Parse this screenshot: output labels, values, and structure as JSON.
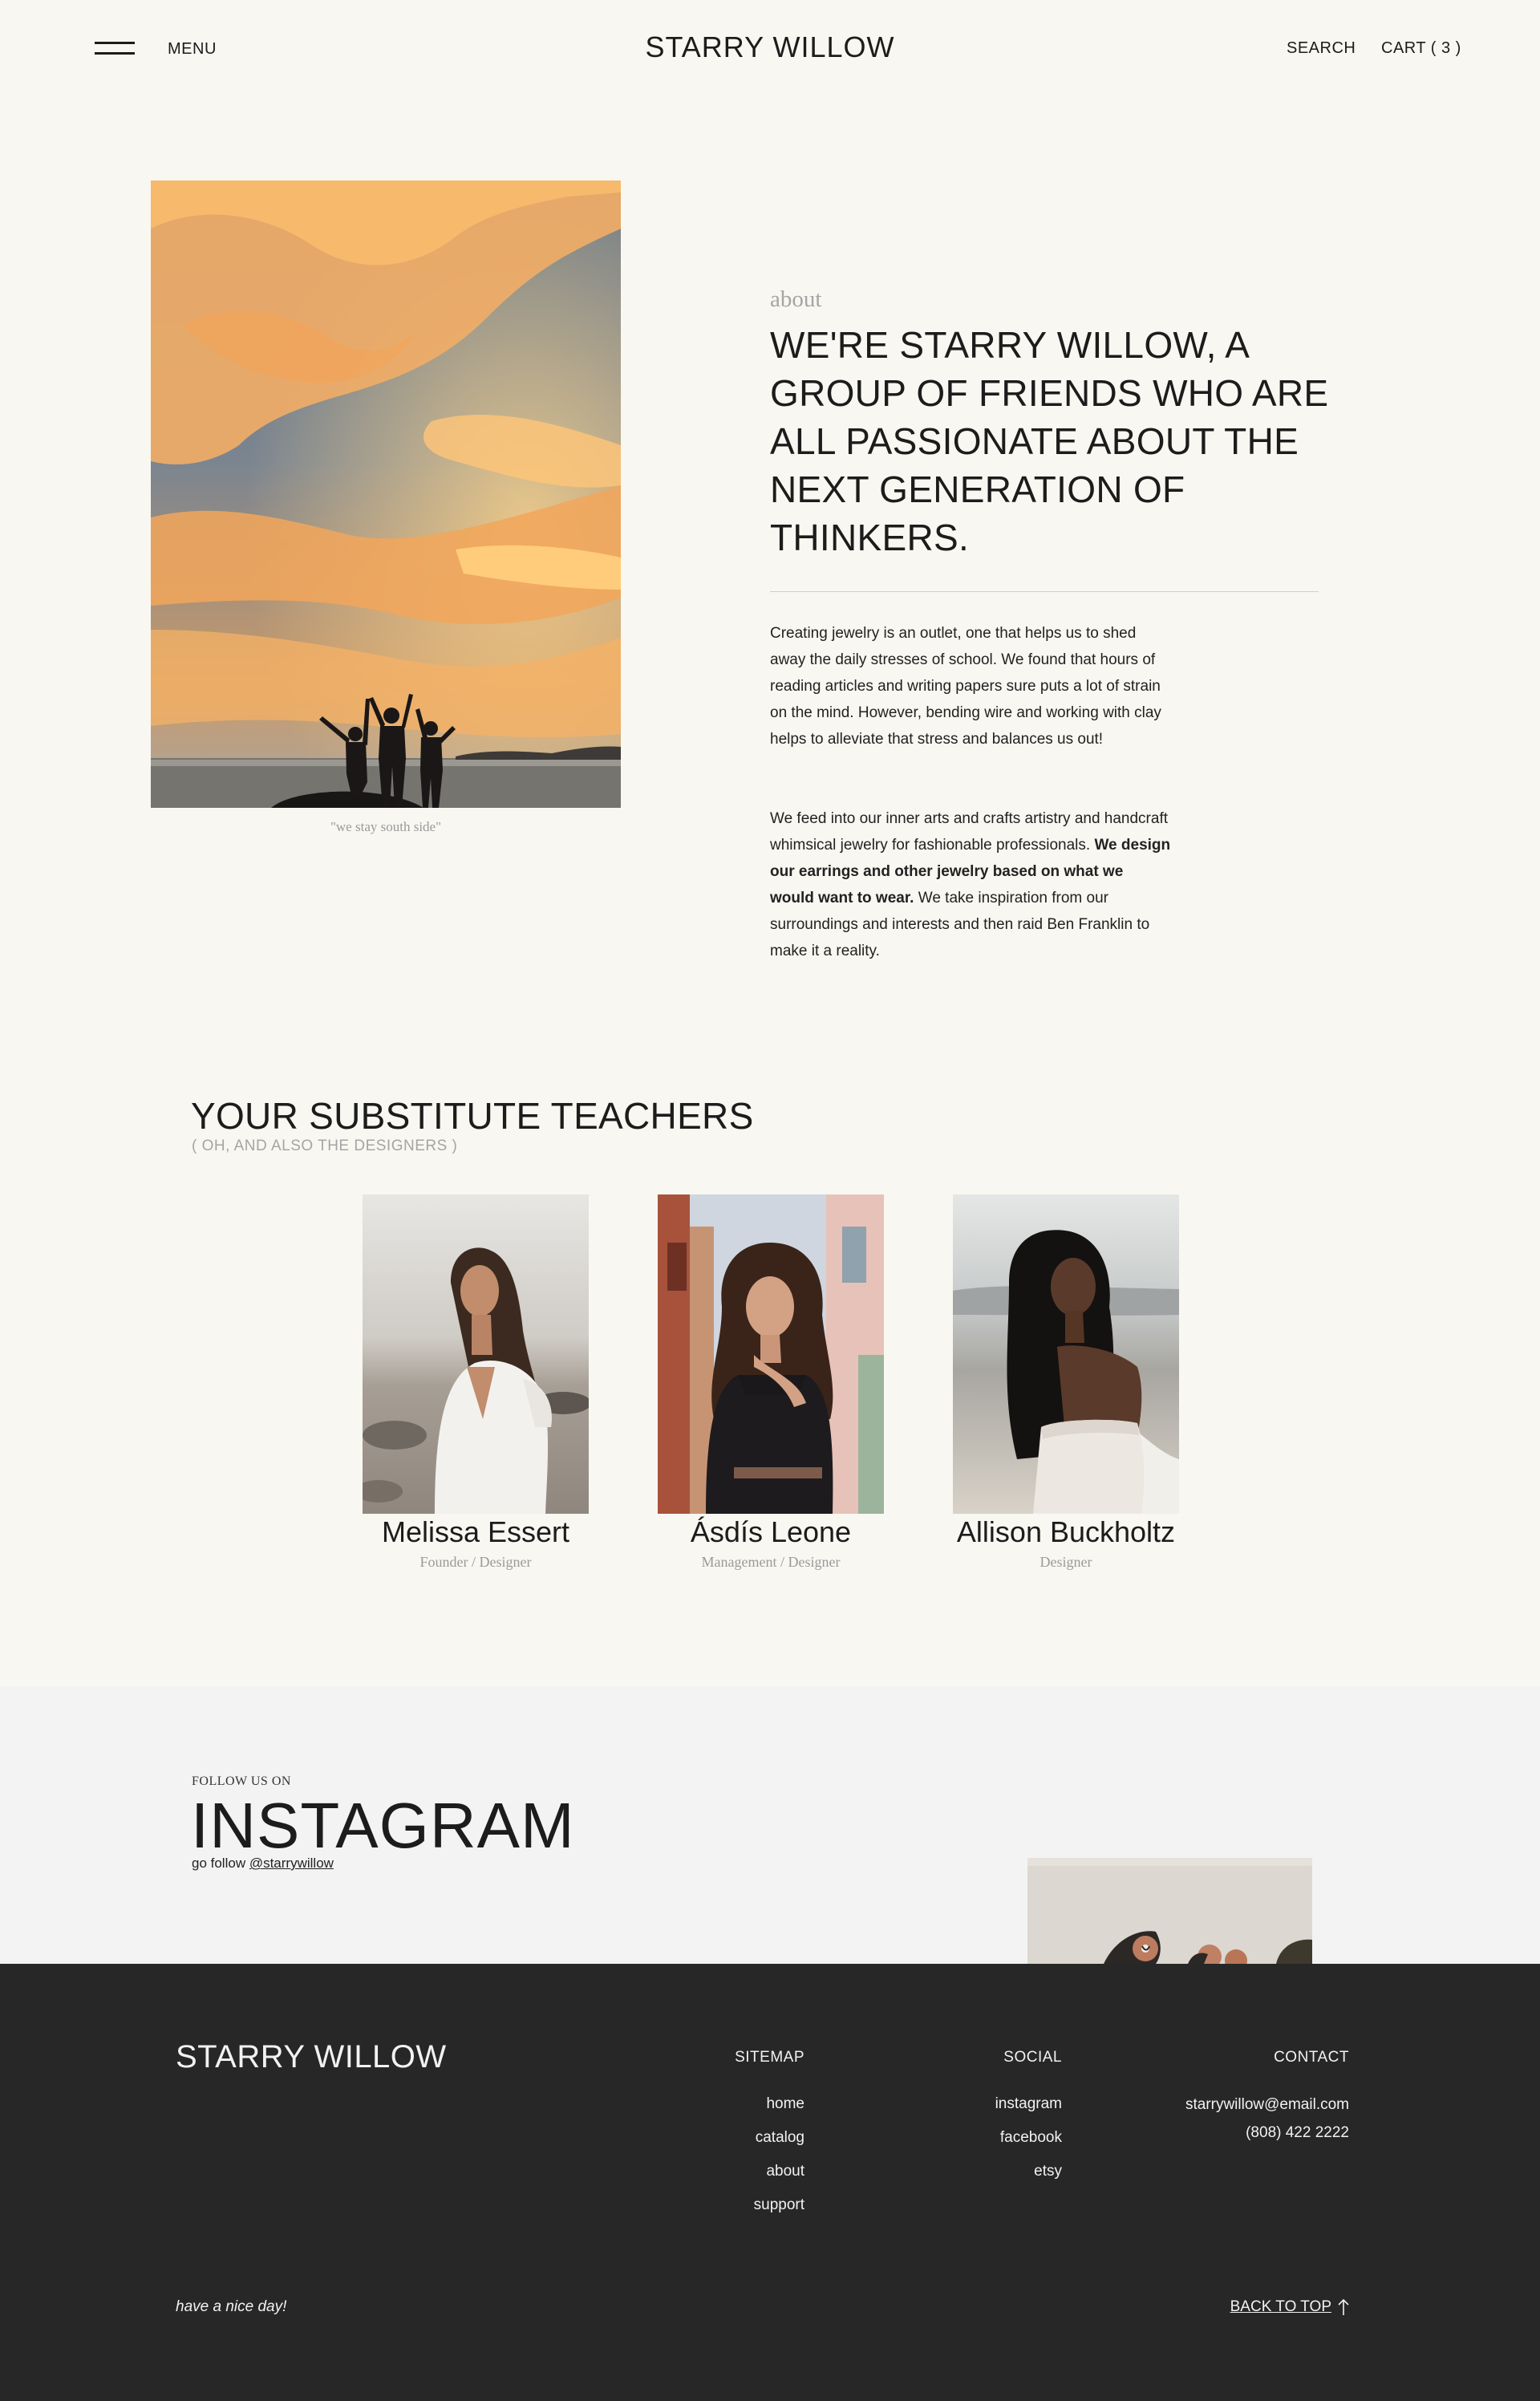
{
  "header": {
    "menu_label": "MENU",
    "brand": "STARRY WILLOW",
    "search_label": "SEARCH",
    "cart_label": "CART ( 3 )"
  },
  "about": {
    "kicker": "about",
    "heading": "WE'RE STARRY WILLOW, A GROUP OF FRIENDS WHO ARE ALL PASSIONATE ABOUT THE NEXT GENERATION OF THINKERS.",
    "photo_caption": "\"we stay south side\"",
    "paragraph1": "Creating jewelry is an outlet, one that helps us to shed away the daily stresses of school. We found that hours of reading articles and writing papers sure puts a lot of strain on the mind. However, bending wire and working with clay helps to alleviate that stress and balances us out!",
    "paragraph2_start": "We feed into our inner arts and crafts artistry and handcraft whimsical jewelry for fashionable professionals. ",
    "paragraph2_bold": "We design our earrings and other jewelry based on what we would want to wear.",
    "paragraph2_end": " We take inspiration from our surroundings and interests and then raid Ben Franklin to make it a reality."
  },
  "team": {
    "title": "YOUR SUBSTITUTE TEACHERS",
    "subtitle": "( OH, AND ALSO THE DESIGNERS )",
    "members": [
      {
        "name": "Melissa Essert",
        "role": "Founder / Designer"
      },
      {
        "name": "Ásdís Leone",
        "role": "Management / Designer"
      },
      {
        "name": "Allison Buckholtz",
        "role": "Designer"
      }
    ]
  },
  "instagram": {
    "kicker": "FOLLOW US ON",
    "title": "INSTAGRAM",
    "follow_text": "go follow ",
    "handle": "@starrywillow"
  },
  "footer": {
    "brand": "STARRY WILLOW",
    "sitemap": {
      "title": "SITEMAP",
      "links": [
        "home",
        "catalog",
        "about",
        "support"
      ]
    },
    "social": {
      "title": "SOCIAL",
      "links": [
        "instagram",
        "facebook",
        "etsy"
      ]
    },
    "contact": {
      "title": "CONTACT",
      "email": "starrywillow@email.com",
      "phone": "(808) 422 2222"
    },
    "tagline": "have a nice day!",
    "back_to_top": "BACK TO TOP"
  },
  "colors": {
    "page_background": "#f8f7f1",
    "instagram_band": "#f3f3f3",
    "footer_background": "#272727",
    "muted_text": "#a5a5a5"
  }
}
